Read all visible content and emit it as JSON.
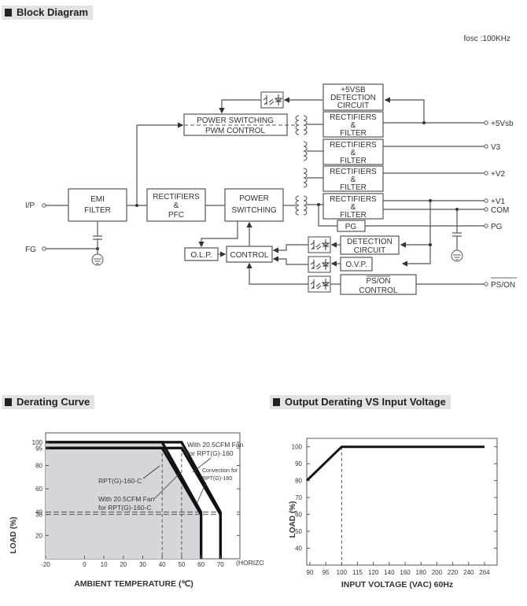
{
  "block_diagram": {
    "header": "Block Diagram",
    "fosc": "fosc :100KHz",
    "blocks": {
      "emi": [
        "EMI",
        "FILTER"
      ],
      "rect_pfc": [
        "RECTIFIERS",
        "&",
        "PFC"
      ],
      "power_switching": [
        "POWER",
        "SWITCHING"
      ],
      "pwm": [
        "POWER SWITCHING",
        "PWM CONTROL"
      ],
      "vsb_detect": [
        "+5VSB",
        "DETECTION",
        "CIRCUIT"
      ],
      "rect_filter": [
        "RECTIFIERS",
        "&",
        "FILTER"
      ],
      "pg": "PG",
      "detection": [
        "DETECTION",
        "CIRCUIT"
      ],
      "ovp": "O.V.P.",
      "pson_control": [
        "PS/ON",
        "CONTROL"
      ],
      "olp": "O.L.P.",
      "control": "CONTROL"
    },
    "inputs": [
      "I/P",
      "FG"
    ],
    "outputs": [
      "+5Vsb",
      "V3",
      "+V2",
      "+V1",
      "COM",
      "PG",
      "PS/ON"
    ]
  },
  "chart_data": [
    {
      "type": "line",
      "title": "Derating Curve",
      "xlabel": "AMBIENT TEMPERATURE (℃)",
      "xlabel_note": "(HORIZONTAL)",
      "ylabel": "LOAD (%)",
      "x_ticks": [
        -20,
        0,
        10,
        20,
        30,
        40,
        50,
        60,
        70
      ],
      "y_ticks": [
        20,
        38,
        40,
        60,
        80,
        95,
        100
      ],
      "xlim": [
        -20,
        70
      ],
      "ylim": [
        0,
        100
      ],
      "series": [
        {
          "name": "RPT(G)-160-C",
          "points": [
            [
              -20,
              95
            ],
            [
              40,
              95
            ],
            [
              60,
              38
            ],
            [
              60,
              0
            ]
          ]
        },
        {
          "name": "With 20.5CFM Fan for RPT(G)-160-C",
          "points": [
            [
              -20,
              100
            ],
            [
              40,
              100
            ],
            [
              60,
              40
            ],
            [
              60,
              0
            ]
          ]
        },
        {
          "name": "Convection for RPT(G)-160",
          "points": [
            [
              -20,
              95
            ],
            [
              50,
              95
            ],
            [
              70,
              38
            ],
            [
              70,
              0
            ]
          ]
        },
        {
          "name": "With 20.5CFM Fan for RPT(G)-160",
          "points": [
            [
              -20,
              100
            ],
            [
              50,
              100
            ],
            [
              70,
              40
            ],
            [
              70,
              0
            ]
          ]
        }
      ],
      "annotations": {
        "rpt_c": "RPT(G)-160-C",
        "fan_c_1": "With 20.5CFM Fan",
        "fan_c_2": "for RPT(G)-160-C",
        "fan_1": "With 20.5CFM Fan",
        "fan_2": "for RPT(G)-160",
        "conv_1": "Convection for",
        "conv_2": "RPT(G)-160"
      }
    },
    {
      "type": "line",
      "title": "Output Derating VS Input Voltage",
      "xlabel": "INPUT VOLTAGE (VAC) 60Hz",
      "ylabel": "LOAD (%)",
      "x_ticks": [
        "90",
        "95",
        "100",
        "115",
        "120",
        "140",
        "160",
        "180",
        "200",
        "220",
        "240",
        "264"
      ],
      "y_ticks": [
        40,
        50,
        60,
        70,
        80,
        90,
        100
      ],
      "ylim": [
        30,
        105
      ],
      "series": [
        {
          "name": "Load",
          "points": [
            [
              "90",
              80
            ],
            [
              "100",
              100
            ],
            [
              "264",
              100
            ]
          ]
        }
      ]
    }
  ]
}
